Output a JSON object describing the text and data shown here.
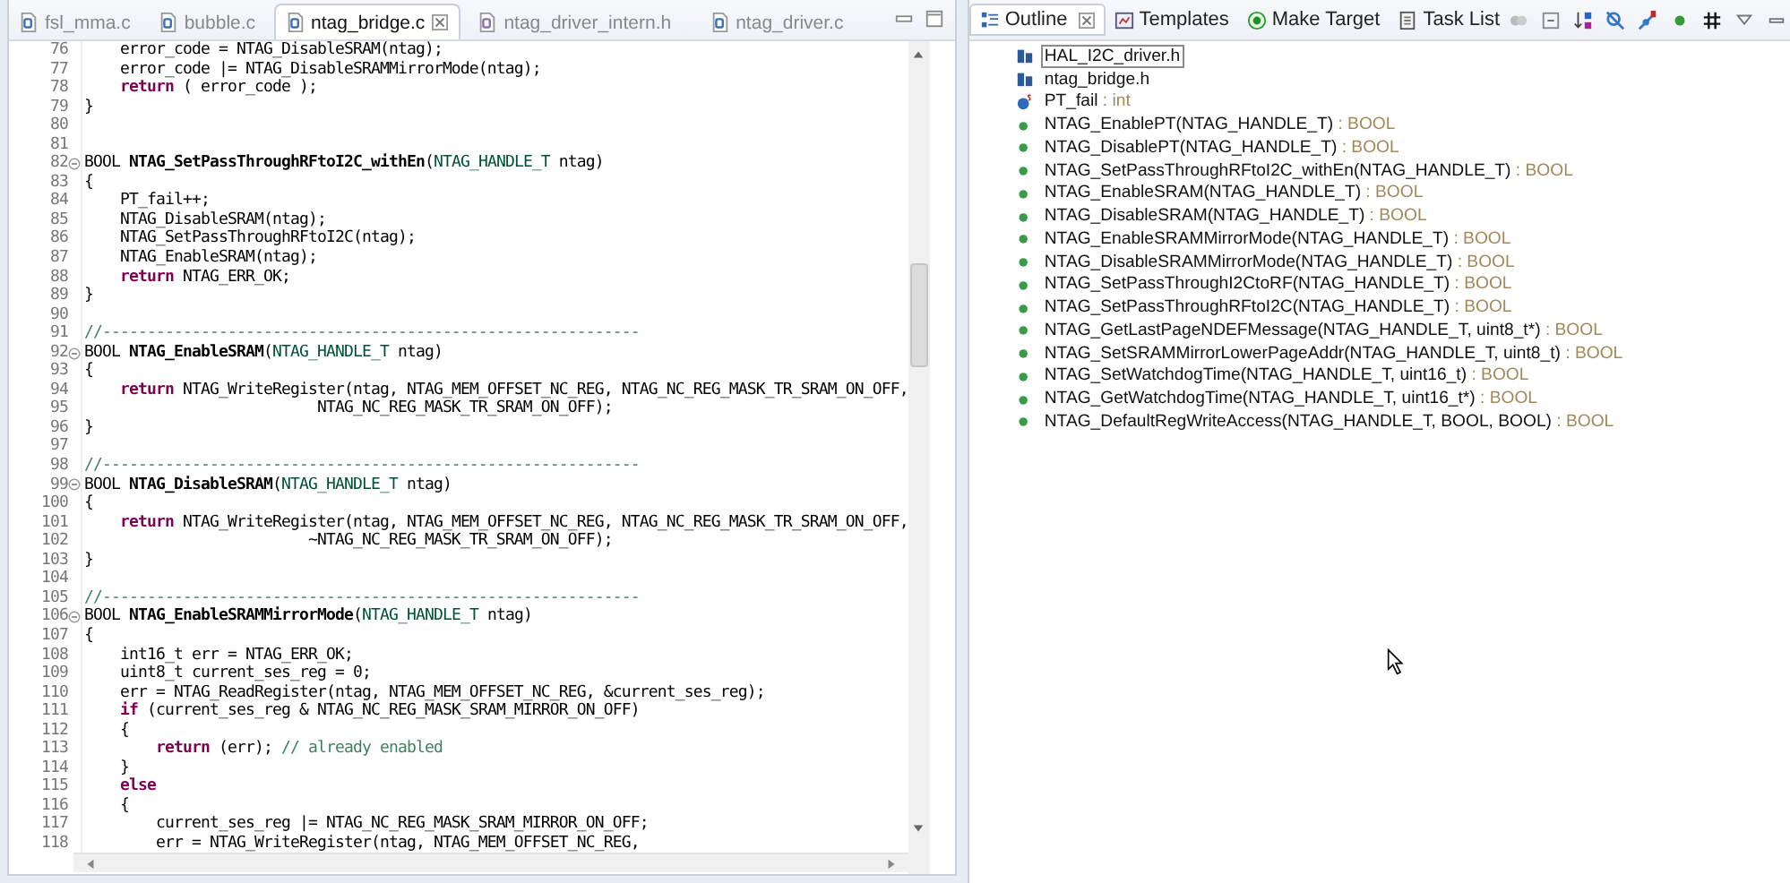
{
  "editor": {
    "tabs": [
      {
        "label": "fsl_mma.c",
        "kind": "c",
        "selected": false
      },
      {
        "label": "bubble.c",
        "kind": "c",
        "selected": false
      },
      {
        "label": "ntag_bridge.c",
        "kind": "c",
        "selected": true
      },
      {
        "label": "ntag_driver_intern.h",
        "kind": "h",
        "selected": false
      },
      {
        "label": "ntag_driver.c",
        "kind": "c",
        "selected": false
      }
    ],
    "lines": [
      {
        "number": "76",
        "segments": [
          {
            "kind": "plain",
            "text": "    error_code = NTAG_DisableSRAM(ntag);"
          }
        ]
      },
      {
        "number": "77",
        "segments": [
          {
            "kind": "plain",
            "text": "    error_code |= NTAG_DisableSRAMMirrorMode(ntag);"
          }
        ]
      },
      {
        "number": "78",
        "segments": [
          {
            "kind": "keyword",
            "text": "    return"
          },
          {
            "kind": "plain",
            "text": " ( error_code );"
          }
        ]
      },
      {
        "number": "79",
        "segments": [
          {
            "kind": "plain",
            "text": "}"
          }
        ]
      },
      {
        "number": "80"
      },
      {
        "number": "81"
      },
      {
        "number": "82",
        "fold": true,
        "segments": [
          {
            "kind": "plain",
            "text": "BOOL "
          },
          {
            "kind": "function",
            "text": "NTAG_SetPassThroughRFtoI2C_withEn"
          },
          {
            "kind": "plain",
            "text": "("
          },
          {
            "kind": "type",
            "text": "NTAG_HANDLE_T"
          },
          {
            "kind": "plain",
            "text": " ntag)"
          }
        ]
      },
      {
        "number": "83",
        "segments": [
          {
            "kind": "plain",
            "text": "{"
          }
        ]
      },
      {
        "number": "84",
        "segments": [
          {
            "kind": "plain",
            "text": "    PT_fail++;"
          }
        ]
      },
      {
        "number": "85",
        "segments": [
          {
            "kind": "plain",
            "text": "    NTAG_DisableSRAM(ntag);"
          }
        ]
      },
      {
        "number": "86",
        "segments": [
          {
            "kind": "plain",
            "text": "    NTAG_SetPassThroughRFtoI2C(ntag);"
          }
        ]
      },
      {
        "number": "87",
        "segments": [
          {
            "kind": "plain",
            "text": "    NTAG_EnableSRAM(ntag);"
          }
        ]
      },
      {
        "number": "88",
        "segments": [
          {
            "kind": "keyword",
            "text": "    return"
          },
          {
            "kind": "plain",
            "text": " NTAG_ERR_OK;"
          }
        ]
      },
      {
        "number": "89",
        "segments": [
          {
            "kind": "plain",
            "text": "}"
          }
        ]
      },
      {
        "number": "90"
      },
      {
        "number": "91",
        "segments": [
          {
            "kind": "comment",
            "text": "//------------------------------------------------------------"
          }
        ]
      },
      {
        "number": "92",
        "fold": true,
        "segments": [
          {
            "kind": "plain",
            "text": "BOOL "
          },
          {
            "kind": "function",
            "text": "NTAG_EnableSRAM"
          },
          {
            "kind": "plain",
            "text": "("
          },
          {
            "kind": "type",
            "text": "NTAG_HANDLE_T"
          },
          {
            "kind": "plain",
            "text": " ntag)"
          }
        ]
      },
      {
        "number": "93",
        "segments": [
          {
            "kind": "plain",
            "text": "{"
          }
        ]
      },
      {
        "number": "94",
        "segments": [
          {
            "kind": "keyword",
            "text": "    return"
          },
          {
            "kind": "plain",
            "text": " NTAG_WriteRegister(ntag, NTAG_MEM_OFFSET_NC_REG, NTAG_NC_REG_MASK_TR_SRAM_ON_OFF,"
          }
        ]
      },
      {
        "number": "95",
        "segments": [
          {
            "kind": "plain",
            "text": "                          NTAG_NC_REG_MASK_TR_SRAM_ON_OFF);"
          }
        ]
      },
      {
        "number": "96",
        "segments": [
          {
            "kind": "plain",
            "text": "}"
          }
        ]
      },
      {
        "number": "97"
      },
      {
        "number": "98",
        "segments": [
          {
            "kind": "comment",
            "text": "//------------------------------------------------------------"
          }
        ]
      },
      {
        "number": "99",
        "fold": true,
        "segments": [
          {
            "kind": "plain",
            "text": "BOOL "
          },
          {
            "kind": "function",
            "text": "NTAG_DisableSRAM"
          },
          {
            "kind": "plain",
            "text": "("
          },
          {
            "kind": "type",
            "text": "NTAG_HANDLE_T"
          },
          {
            "kind": "plain",
            "text": " ntag)"
          }
        ]
      },
      {
        "number": "100",
        "segments": [
          {
            "kind": "plain",
            "text": "{"
          }
        ]
      },
      {
        "number": "101",
        "segments": [
          {
            "kind": "keyword",
            "text": "    return"
          },
          {
            "kind": "plain",
            "text": " NTAG_WriteRegister(ntag, NTAG_MEM_OFFSET_NC_REG, NTAG_NC_REG_MASK_TR_SRAM_ON_OFF,"
          }
        ]
      },
      {
        "number": "102",
        "segments": [
          {
            "kind": "plain",
            "text": "                         ~NTAG_NC_REG_MASK_TR_SRAM_ON_OFF);"
          }
        ]
      },
      {
        "number": "103",
        "segments": [
          {
            "kind": "plain",
            "text": "}"
          }
        ]
      },
      {
        "number": "104"
      },
      {
        "number": "105",
        "segments": [
          {
            "kind": "comment",
            "text": "//------------------------------------------------------------"
          }
        ]
      },
      {
        "number": "106",
        "fold": true,
        "segments": [
          {
            "kind": "plain",
            "text": "BOOL "
          },
          {
            "kind": "function",
            "text": "NTAG_EnableSRAMMirrorMode"
          },
          {
            "kind": "plain",
            "text": "("
          },
          {
            "kind": "type",
            "text": "NTAG_HANDLE_T"
          },
          {
            "kind": "plain",
            "text": " ntag)"
          }
        ]
      },
      {
        "number": "107",
        "segments": [
          {
            "kind": "plain",
            "text": "{"
          }
        ]
      },
      {
        "number": "108",
        "segments": [
          {
            "kind": "plain",
            "text": "    int16_t err = NTAG_ERR_OK;"
          }
        ]
      },
      {
        "number": "109",
        "segments": [
          {
            "kind": "plain",
            "text": "    uint8_t current_ses_reg = 0;"
          }
        ]
      },
      {
        "number": "110",
        "segments": [
          {
            "kind": "plain",
            "text": "    err = NTAG_ReadRegister(ntag, NTAG_MEM_OFFSET_NC_REG, &current_ses_reg);"
          }
        ]
      },
      {
        "number": "111",
        "segments": [
          {
            "kind": "keyword",
            "text": "    if"
          },
          {
            "kind": "plain",
            "text": " (current_ses_reg & NTAG_NC_REG_MASK_SRAM_MIRROR_ON_OFF)"
          }
        ]
      },
      {
        "number": "112",
        "segments": [
          {
            "kind": "plain",
            "text": "    {"
          }
        ]
      },
      {
        "number": "113",
        "segments": [
          {
            "kind": "keyword",
            "text": "        return"
          },
          {
            "kind": "plain",
            "text": " (err); "
          },
          {
            "kind": "comment",
            "text": "// already enabled"
          }
        ]
      },
      {
        "number": "114",
        "segments": [
          {
            "kind": "plain",
            "text": "    }"
          }
        ]
      },
      {
        "number": "115",
        "segments": [
          {
            "kind": "keyword",
            "text": "    else"
          }
        ]
      },
      {
        "number": "116",
        "segments": [
          {
            "kind": "plain",
            "text": "    {"
          }
        ]
      },
      {
        "number": "117",
        "segments": [
          {
            "kind": "plain",
            "text": "        current_ses_reg |= NTAG_NC_REG_MASK_SRAM_MIRROR_ON_OFF;"
          }
        ]
      },
      {
        "number": "118",
        "segments": [
          {
            "kind": "plain",
            "text": "        err = NTAG_WriteRegister(ntag, NTAG_MEM_OFFSET_NC_REG,"
          }
        ]
      }
    ]
  },
  "outline": {
    "tabs": [
      {
        "label": "Outline",
        "kind": "outline",
        "selected": true
      },
      {
        "label": "Templates",
        "kind": "templates",
        "selected": false
      },
      {
        "label": "Make Target",
        "kind": "target",
        "selected": false
      },
      {
        "label": "Task List",
        "kind": "tasks",
        "selected": false
      }
    ],
    "items": [
      {
        "kind": "include",
        "name": "HAL_I2C_driver.h",
        "selected": true
      },
      {
        "kind": "include",
        "name": "ntag_bridge.h",
        "selected": false
      },
      {
        "kind": "variable",
        "name": "PT_fail",
        "type": ": int",
        "selected": false
      },
      {
        "kind": "function",
        "name": "NTAG_EnablePT(NTAG_HANDLE_T)",
        "type": ": BOOL",
        "selected": false
      },
      {
        "kind": "function",
        "name": "NTAG_DisablePT(NTAG_HANDLE_T)",
        "type": ": BOOL",
        "selected": false
      },
      {
        "kind": "function",
        "name": "NTAG_SetPassThroughRFtoI2C_withEn(NTAG_HANDLE_T)",
        "type": ": BOOL",
        "selected": false
      },
      {
        "kind": "function",
        "name": "NTAG_EnableSRAM(NTAG_HANDLE_T)",
        "type": ": BOOL",
        "selected": false
      },
      {
        "kind": "function",
        "name": "NTAG_DisableSRAM(NTAG_HANDLE_T)",
        "type": ": BOOL",
        "selected": false
      },
      {
        "kind": "function",
        "name": "NTAG_EnableSRAMMirrorMode(NTAG_HANDLE_T)",
        "type": ": BOOL",
        "selected": false
      },
      {
        "kind": "function",
        "name": "NTAG_DisableSRAMMirrorMode(NTAG_HANDLE_T)",
        "type": ": BOOL",
        "selected": false
      },
      {
        "kind": "function",
        "name": "NTAG_SetPassThroughI2CtoRF(NTAG_HANDLE_T)",
        "type": ": BOOL",
        "selected": false
      },
      {
        "kind": "function",
        "name": "NTAG_SetPassThroughRFtoI2C(NTAG_HANDLE_T)",
        "type": ": BOOL",
        "selected": false
      },
      {
        "kind": "function",
        "name": "NTAG_GetLastPageNDEFMessage(NTAG_HANDLE_T, uint8_t*)",
        "type": ": BOOL",
        "selected": false
      },
      {
        "kind": "function",
        "name": "NTAG_SetSRAMMirrorLowerPageAddr(NTAG_HANDLE_T, uint8_t)",
        "type": ": BOOL",
        "selected": false
      },
      {
        "kind": "function",
        "name": "NTAG_SetWatchdogTime(NTAG_HANDLE_T, uint16_t)",
        "type": ": BOOL",
        "selected": false
      },
      {
        "kind": "function",
        "name": "NTAG_GetWatchdogTime(NTAG_HANDLE_T, uint16_t*)",
        "type": ": BOOL",
        "selected": false
      },
      {
        "kind": "function",
        "name": "NTAG_DefaultRegWriteAccess(NTAG_HANDLE_T, BOOL, BOOL)",
        "type": ": BOOL",
        "selected": false
      }
    ]
  }
}
